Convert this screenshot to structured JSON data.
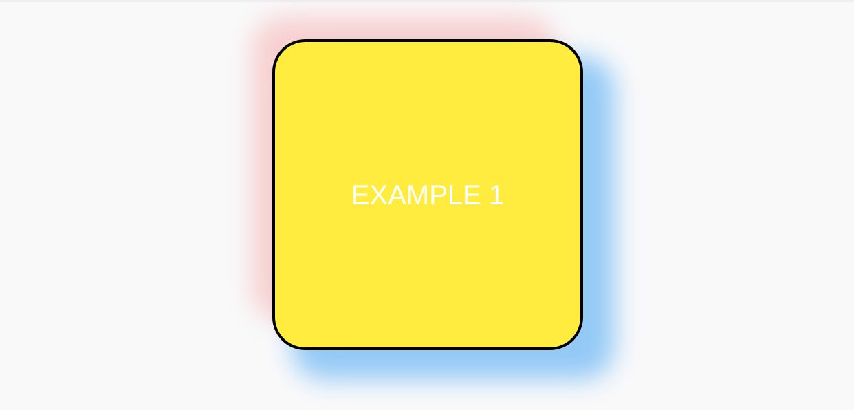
{
  "card": {
    "label": "EXAMPLE 1"
  },
  "colors": {
    "background": "#f9f9fa",
    "card_fill": "#ffec3e",
    "card_border": "#000000",
    "label_text": "#ffffff",
    "glow_red": "#f7c9c9",
    "glow_blue": "#8fc7f6"
  }
}
